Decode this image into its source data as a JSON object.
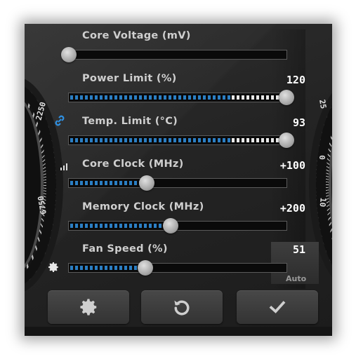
{
  "sliders": [
    {
      "id": "core-voltage",
      "label": "Core Voltage (mV)",
      "value": "",
      "position": 0.0,
      "fill": "none"
    },
    {
      "id": "power-limit",
      "label": "Power Limit (%)",
      "value": "120",
      "position": 1.0,
      "fill": "full"
    },
    {
      "id": "temp-limit",
      "label": "Temp. Limit (°C)",
      "value": "93",
      "position": 1.0,
      "fill": "full"
    },
    {
      "id": "core-clock",
      "label": "Core Clock (MHz)",
      "value": "+100",
      "position": 0.36,
      "fill": "partial"
    },
    {
      "id": "memory-clock",
      "label": "Memory Clock (MHz)",
      "value": "+200",
      "position": 0.46,
      "fill": "partial"
    },
    {
      "id": "fan-speed",
      "label": "Fan Speed (%)",
      "value": "51",
      "position": 0.35,
      "fill": "partial"
    }
  ],
  "fan_auto_label": "Auto",
  "gauge_left_labels": [
    "2250",
    "6750"
  ],
  "gauge_right_labels": [
    "25",
    "0",
    "10"
  ],
  "buttons": {
    "settings_icon": "gear-icon",
    "reset_icon": "reset-icon",
    "apply_icon": "check-icon"
  },
  "colors": {
    "accent": "#2b7fc4",
    "link_icon": "#2f8fe0",
    "panel": "#262626"
  }
}
